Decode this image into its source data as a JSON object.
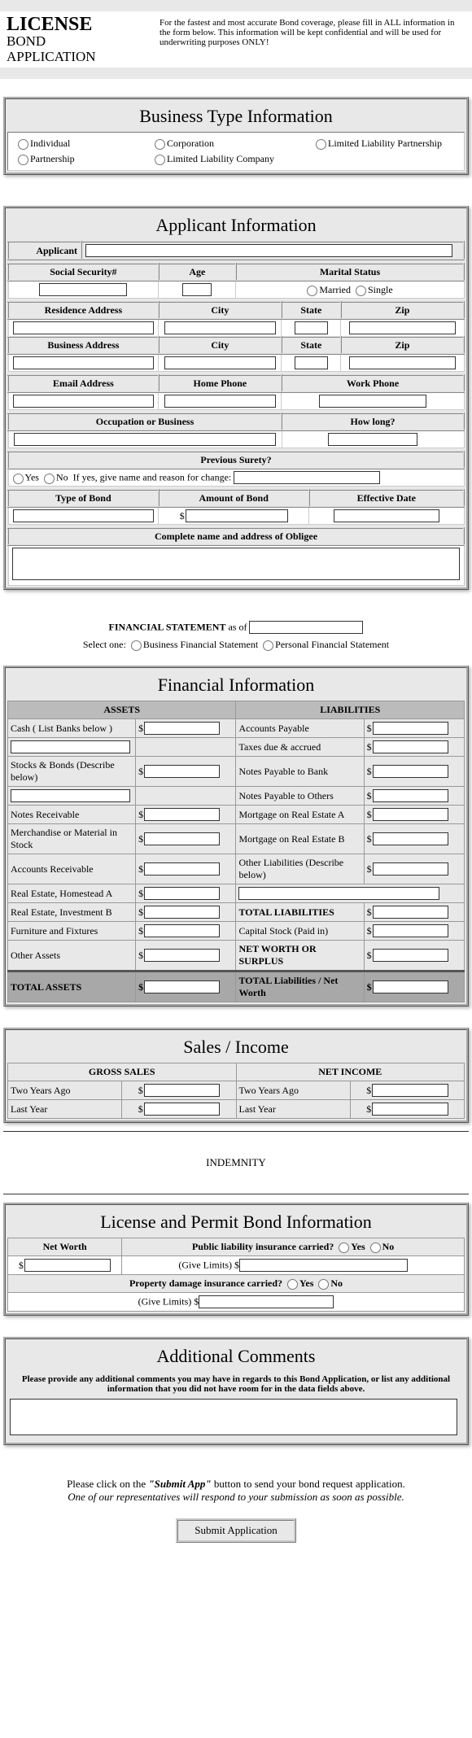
{
  "header": {
    "title": "LICENSE",
    "sub1": "BOND",
    "sub2": "APPLICATION",
    "blurb": "For the fastest and most accurate Bond coverage, please fill in ALL information in the form below. This information will be kept confidential and will be used for underwriting purposes ONLY!"
  },
  "biz": {
    "title": "Business Type Information",
    "opt1": "Individual",
    "opt2": "Corporation",
    "opt3": "Limited Liability Partnership",
    "opt4": "Partnership",
    "opt5": "Limited Liability Company"
  },
  "app": {
    "title": "Applicant Information",
    "applicant": "Applicant",
    "ssn": "Social Security#",
    "age": "Age",
    "marital": "Marital Status",
    "married": "Married",
    "single": "Single",
    "res_addr": "Residence Address",
    "city": "City",
    "state": "State",
    "zip": "Zip",
    "biz_addr": "Business Address",
    "email": "Email Address",
    "hphone": "Home Phone",
    "wphone": "Work Phone",
    "occ": "Occupation or Business",
    "howlong": "How long?",
    "prev": "Previous Surety?",
    "yes": "Yes",
    "no": "No",
    "ifyes": "If yes, give name and reason for change:",
    "bondtype": "Type of Bond",
    "amount": "Amount of Bond",
    "effdate": "Effective Date",
    "obligee": "Complete name and address of Obligee"
  },
  "finstmt": {
    "label": "FINANCIAL STATEMENT",
    "asof": "as of",
    "select": "Select one:",
    "opt1": "Business Financial Statement",
    "opt2": "Personal Financial Statement"
  },
  "fin": {
    "title": "Financial Information",
    "assets": "ASSETS",
    "liab": "LIABILITIES",
    "a1": "Cash ( List Banks below )",
    "l1": "Accounts Payable",
    "l2": "Taxes due & accrued",
    "a3": "Stocks & Bonds (Describe below)",
    "l3": "Notes Payable to Bank",
    "l4": "Notes Payable to Others",
    "a5": "Notes Receivable",
    "l5": "Mortgage on Real Estate A",
    "a6": "Merchandise or Material in Stock",
    "l6": "Mortgage on Real Estate B",
    "a7": "Accounts Receivable",
    "l7": "Other Liabilities (Describe below)",
    "a8": "Real Estate, Homestead A",
    "a9": "Real Estate, Investment B",
    "l9": "TOTAL LIABILITIES",
    "a10": "Furniture and Fixtures",
    "l10": "Capital Stock (Paid in)",
    "a11": "Other Assets",
    "l11": "NET WORTH OR SURPLUS",
    "atot": "TOTAL ASSETS",
    "ltot": "TOTAL Liabilities / Net Worth"
  },
  "sales": {
    "title": "Sales / Income",
    "gross": "GROSS SALES",
    "net": "NET INCOME",
    "two": "Two Years Ago",
    "last": "Last Year"
  },
  "indem": "INDEMNITY",
  "lic": {
    "title": "License and Permit Bond Information",
    "networth": "Net Worth",
    "pub": "Public liability insurance carried?",
    "yes": "Yes",
    "no": "No",
    "limits": "(Give Limits)",
    "prop": "Property damage insurance carried?"
  },
  "addl": {
    "title": "Additional Comments",
    "blurb": "Please provide any additional comments you may have in regards to this Bond Application, or list any additional information that you did not have room for in the data fields above."
  },
  "footer": {
    "note1a": "Please click on the ",
    "note1b": "\"Submit App\"",
    "note1c": " button to send your bond request application.",
    "note2": "One of our representatives will respond to your submission as soon as possible.",
    "submit": "Submit Application"
  }
}
